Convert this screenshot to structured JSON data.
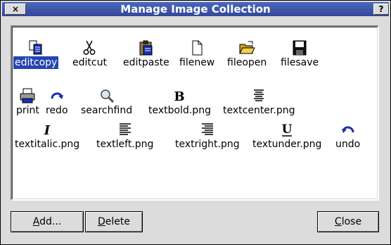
{
  "window": {
    "title": "Manage Image Collection",
    "close_glyph": "×",
    "help_glyph": "?"
  },
  "icons": [
    {
      "label": "editcopy",
      "icon": "editcopy-icon",
      "selected": true
    },
    {
      "label": "editcut",
      "icon": "scissors-icon",
      "selected": false
    },
    {
      "label": "editpaste",
      "icon": "clipboard-icon",
      "selected": false
    },
    {
      "label": "filenew",
      "icon": "new-file-icon",
      "selected": false
    },
    {
      "label": "fileopen",
      "icon": "open-folder-icon",
      "selected": false
    },
    {
      "label": "filesave",
      "icon": "floppy-disk-icon",
      "selected": false
    },
    {
      "label": "print",
      "icon": "printer-icon",
      "selected": false
    },
    {
      "label": "redo",
      "icon": "redo-arrow-icon",
      "selected": false
    },
    {
      "label": "searchfind",
      "icon": "magnifier-icon",
      "selected": false
    },
    {
      "label": "textbold.png",
      "icon": "bold-b-icon",
      "selected": false
    },
    {
      "label": "textcenter.png",
      "icon": "align-center-icon",
      "selected": false
    },
    {
      "label": "textitalic.png",
      "icon": "italic-i-icon",
      "selected": false
    },
    {
      "label": "textleft.png",
      "icon": "align-left-icon",
      "selected": false
    },
    {
      "label": "textright.png",
      "icon": "align-right-icon",
      "selected": false
    },
    {
      "label": "textunder.png",
      "icon": "underline-u-icon",
      "selected": false
    },
    {
      "label": "undo",
      "icon": "undo-arrow-icon",
      "selected": false
    }
  ],
  "buttons": {
    "add": {
      "mnemonic": "A",
      "rest": "dd..."
    },
    "delete": {
      "mnemonic": "D",
      "rest": "elete"
    },
    "close": {
      "mnemonic": "C",
      "rest": "lose"
    }
  },
  "colors": {
    "selection": "#2545b0",
    "titlebar": "#2a3f95",
    "icon_blue": "#1a2fb0"
  }
}
